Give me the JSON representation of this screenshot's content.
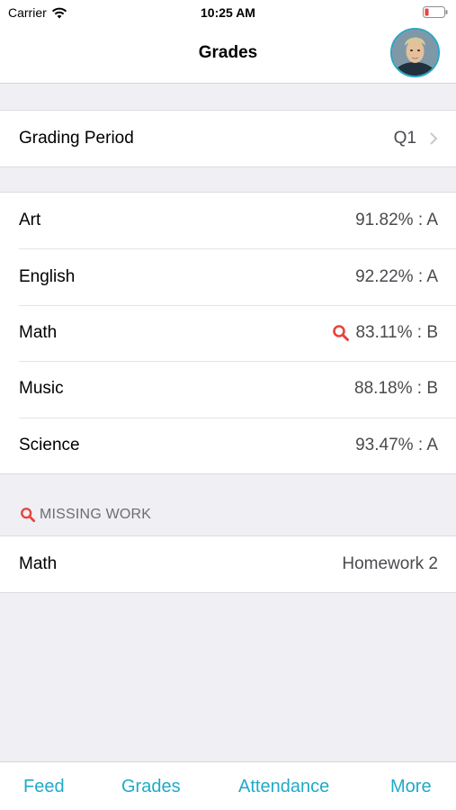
{
  "status_bar": {
    "carrier": "Carrier",
    "time": "10:25 AM"
  },
  "nav": {
    "title": "Grades"
  },
  "grading_period": {
    "label": "Grading Period",
    "value": "Q1"
  },
  "grades": [
    {
      "subject": "Art",
      "grade": "91.82% : A",
      "flagged": false
    },
    {
      "subject": "English",
      "grade": "92.22% : A",
      "flagged": false
    },
    {
      "subject": "Math",
      "grade": "83.11% : B",
      "flagged": true
    },
    {
      "subject": "Music",
      "grade": "88.18% : B",
      "flagged": false
    },
    {
      "subject": "Science",
      "grade": "93.47% : A",
      "flagged": false
    }
  ],
  "missing_work": {
    "header": "MISSING WORK",
    "items": [
      {
        "subject": "Math",
        "assignment": "Homework 2"
      }
    ]
  },
  "tabs": [
    {
      "label": "Feed"
    },
    {
      "label": "Grades"
    },
    {
      "label": "Attendance"
    },
    {
      "label": "More"
    }
  ],
  "colors": {
    "accent": "#20aac8",
    "alert": "#e8413d",
    "background": "#efeff4"
  },
  "icons": [
    "wifi-icon",
    "battery-icon",
    "avatar",
    "chevron-right-icon",
    "search-icon"
  ]
}
